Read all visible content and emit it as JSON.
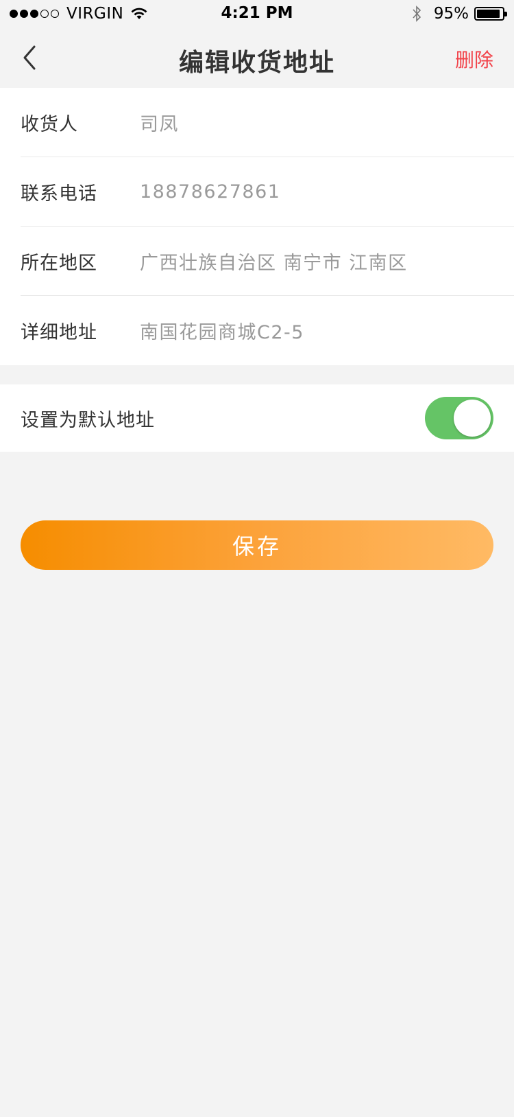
{
  "status_bar": {
    "carrier": "VIRGIN",
    "time": "4:21 PM",
    "battery": "95%",
    "signal_dots_filled": 3,
    "signal_dots_total": 5
  },
  "nav": {
    "back_icon": "chevron-left-icon",
    "title": "编辑收货地址",
    "action_label": "删除",
    "action_color": "#f2434a"
  },
  "form": {
    "rows": [
      {
        "label": "收货人",
        "value": "司凤"
      },
      {
        "label": "联系电话",
        "value": "18878627861"
      },
      {
        "label": "所在地区",
        "value": "广西壮族自治区 南宁市 江南区"
      },
      {
        "label": "详细地址",
        "value": "南国花园商城C2-5"
      }
    ]
  },
  "default_address": {
    "label": "设置为默认地址",
    "enabled": true,
    "toggle_color": "#65c466"
  },
  "save_button": {
    "label": "保存",
    "gradient_start": "#f68d00",
    "gradient_end": "#ffba64"
  }
}
